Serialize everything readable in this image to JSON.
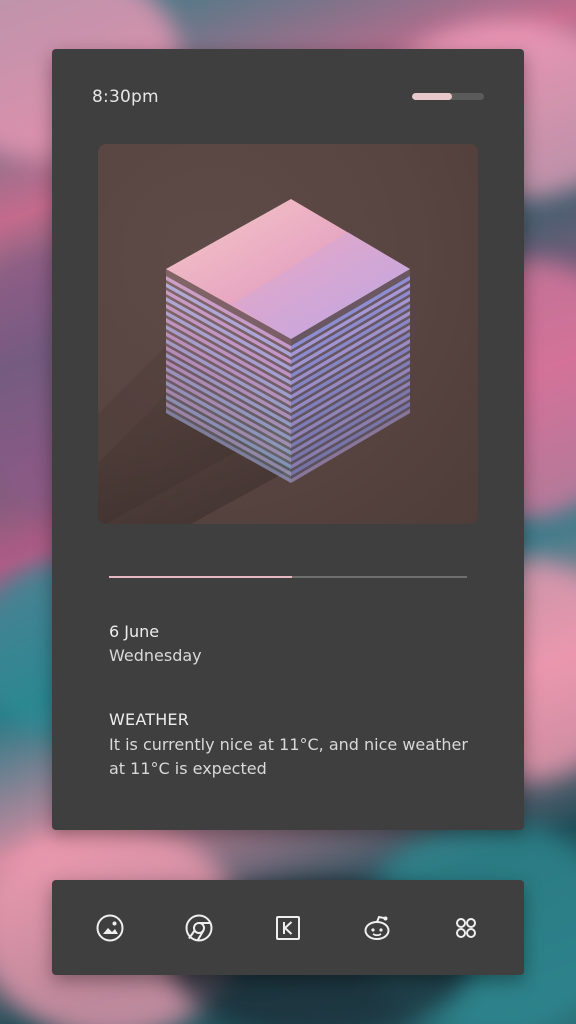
{
  "status": {
    "time": "8:30pm",
    "battery_level": 0.55
  },
  "media": {
    "album_art": "isometric-stacked-cube-artwork",
    "progress": 0.51
  },
  "date": {
    "day": "6 June",
    "weekday": "Wednesday"
  },
  "weather": {
    "title": "WEATHER",
    "description": "It is currently nice at 11°C, and nice weather at 11°C is expected"
  },
  "dock": {
    "items": [
      {
        "icon": "gallery-icon"
      },
      {
        "icon": "chrome-icon"
      },
      {
        "icon": "kustom-icon"
      },
      {
        "icon": "reddit-icon"
      },
      {
        "icon": "apps-grid-icon"
      }
    ]
  },
  "colors": {
    "card_bg": "#3f3f3f",
    "accent": "#e5b8c2",
    "text": "#e6e6e6"
  }
}
